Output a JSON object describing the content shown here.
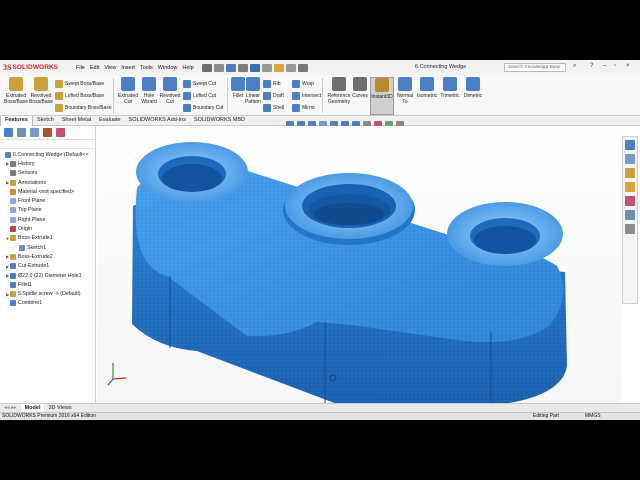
{
  "app": {
    "logo_ds": "3S",
    "logo_text": "SOLIDWORKS",
    "menus": [
      "File",
      "Edit",
      "View",
      "Insert",
      "Tools",
      "Window",
      "Help"
    ],
    "document_title": "6.Connecting Wedge",
    "search_placeholder": "Search Knowledge Base"
  },
  "command_manager": {
    "big_buttons": [
      {
        "label1": "Extruded",
        "label2": "Boss/Base",
        "color": "#c9a23b"
      },
      {
        "label1": "Revolved",
        "label2": "Boss/Base",
        "color": "#c9a23b"
      },
      {
        "label1": "Extruded",
        "label2": "Cut",
        "color": "#4d7fc4"
      },
      {
        "label1": "Hole",
        "label2": "Wizard",
        "color": "#4d7fc4"
      },
      {
        "label1": "Revolved",
        "label2": "Cut",
        "color": "#4d7fc4"
      },
      {
        "label1": "Fillet",
        "label2": "",
        "color": "#4d7fc4"
      },
      {
        "label1": "Linear",
        "label2": "Pattern",
        "color": "#4d7fc4"
      },
      {
        "label1": "Reference",
        "label2": "Geometry",
        "color": "#6f6f6f"
      },
      {
        "label1": "Curves",
        "label2": "",
        "color": "#6f6f6f"
      },
      {
        "label1": "Instant3D",
        "label2": "",
        "color": "#b88a28"
      },
      {
        "label1": "Normal",
        "label2": "To",
        "color": "#4d7fc4"
      },
      {
        "label1": "Isometric",
        "label2": "",
        "color": "#4d7fc4"
      },
      {
        "label1": "Trimetric",
        "label2": "",
        "color": "#4d7fc4"
      },
      {
        "label1": "Dimetric",
        "label2": "",
        "color": "#4d7fc4"
      }
    ],
    "small_buttons": {
      "swept_boss": "Swept Boss/Base",
      "lofted_boss": "Lofted Boss/Base",
      "boundary_boss": "Boundary Boss/Base",
      "swept_cut": "Swept Cut",
      "lofted_cut": "Lofted Cut",
      "boundary_cut": "Boundary Cut",
      "rib": "Rib",
      "draft": "Draft",
      "shell": "Shell",
      "wrap": "Wrap",
      "intersect": "Intersect",
      "mirror": "Mirror"
    }
  },
  "tabs": [
    "Features",
    "Sketch",
    "Sheet Metal",
    "Evaluate",
    "SOLIDWORKS Add-Ins",
    "SOLIDWORKS MBD"
  ],
  "feature_tree": [
    {
      "label": "6.Connecting Wedge  (Default<<",
      "color": "#4c86c6",
      "arrow": ""
    },
    {
      "label": "History",
      "color": "#7a7a7a",
      "arrow": "▶"
    },
    {
      "label": "Sensors",
      "color": "#7a7a7a",
      "arrow": ""
    },
    {
      "label": "Annotations",
      "color": "#c9a23b",
      "arrow": "▶"
    },
    {
      "label": "Material <not specified>",
      "color": "#c98a3b",
      "arrow": ""
    },
    {
      "label": "Front Plane",
      "color": "#8aa9d6",
      "arrow": ""
    },
    {
      "label": "Top Plane",
      "color": "#8aa9d6",
      "arrow": ""
    },
    {
      "label": "Right Plane",
      "color": "#8aa9d6",
      "arrow": ""
    },
    {
      "label": "Origin",
      "color": "#b44",
      "arrow": ""
    },
    {
      "label": "Boss-Extrude1",
      "color": "#c9a23b",
      "arrow": "▼"
    },
    {
      "label": "Sketch1",
      "color": "#6c8fbf",
      "arrow": ""
    },
    {
      "label": "Boss-Extrude2",
      "color": "#c9a23b",
      "arrow": "▶"
    },
    {
      "label": "Cut-Extrude1",
      "color": "#4d7fc4",
      "arrow": "▶"
    },
    {
      "label": "Ø22.0 (22) Diameter Hole1",
      "color": "#4d7fc4",
      "arrow": "▶"
    },
    {
      "label": "Fillet1",
      "color": "#4d7fc4",
      "arrow": ""
    },
    {
      "label": "5.Spidle screw -> (Default)",
      "color": "#c9a23b",
      "arrow": "▶"
    },
    {
      "label": "Combine1",
      "color": "#4d7fc4",
      "arrow": ""
    }
  ],
  "bottom_tabs": [
    "Model",
    "3D Views"
  ],
  "status": {
    "edition": "SOLIDWORKS Premium 2016 x64 Edition",
    "mode": "Editing Part",
    "units": "MMGS"
  },
  "colors": {
    "part_blue": "#2f7fd0",
    "part_dark": "#1c5fa6",
    "part_light": "#6db6f0",
    "brand_red": "#d1202f"
  }
}
